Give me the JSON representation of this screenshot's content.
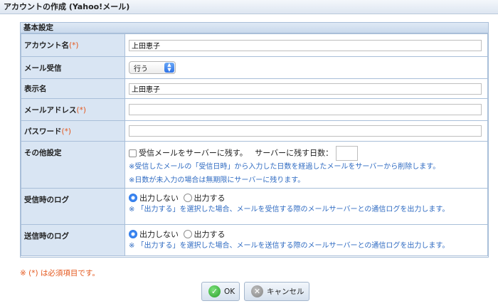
{
  "window": {
    "title": "アカウントの作成 (Yahoo!メール)"
  },
  "panel": {
    "title": "基本設定"
  },
  "fields": {
    "account_name": {
      "label": "アカウント名",
      "required": "(*)",
      "value": "上田恵子"
    },
    "mail_receive": {
      "label": "メール受信",
      "selected": "行う"
    },
    "display_name": {
      "label": "表示名",
      "value": "上田恵子"
    },
    "email": {
      "label": "メールアドレス",
      "required": "(*)",
      "value": ""
    },
    "password": {
      "label": "パスワード",
      "required": "(*)",
      "value": ""
    },
    "other": {
      "label": "その他設定",
      "leave_on_server": "受信メールをサーバーに残す。",
      "days_label": "サーバーに残す日数：",
      "days_value": "",
      "note1": "※受信したメールの「受信日時」から入力した日数を経過したメールをサーバーから削除します。",
      "note2": "※日数が未入力の場合は無期限にサーバーに残ります。"
    },
    "receive_log": {
      "label": "受信時のログ",
      "option_off": "出力しない",
      "option_on": "出力する",
      "selected": "出力しない",
      "note": "※ 「出力する」を選択した場合、メールを受信する際のメールサーバーとの通信ログを出力します。"
    },
    "send_log": {
      "label": "送信時のログ",
      "option_off": "出力しない",
      "option_on": "出力する",
      "selected": "出力しない",
      "note": "※ 「出力する」を選択した場合、メールを送信する際のメールサーバーとの通信ログを出力します。"
    }
  },
  "required_note": "※ (*) は必須項目です。",
  "buttons": {
    "ok": "OK",
    "cancel": "キャンセル"
  },
  "icons": {
    "ok": "check-circle-icon",
    "cancel": "x-circle-icon",
    "select": "up-down-arrows-icon"
  },
  "colors": {
    "required": "#e4571c",
    "note": "#2f6bc2",
    "label_bg": "#d9e5f3"
  }
}
